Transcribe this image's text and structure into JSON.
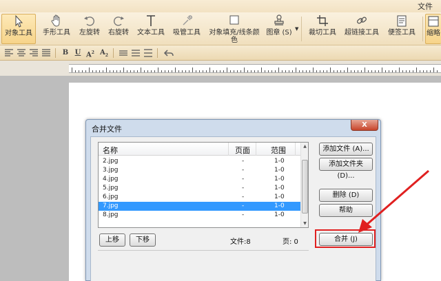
{
  "menu": {
    "file": "文件"
  },
  "toolbar": {
    "tools": [
      {
        "label": "对象工具",
        "icon": "cursor-arrow-icon"
      },
      {
        "label": "手形工具",
        "icon": "hand-icon"
      },
      {
        "label": "左旋转",
        "icon": "rotate-left-icon"
      },
      {
        "label": "右旋转",
        "icon": "rotate-right-icon"
      },
      {
        "label": "文本工具",
        "icon": "text-t-icon"
      },
      {
        "label": "吸管工具",
        "icon": "eyedropper-icon"
      },
      {
        "label": "对象填充/线条颜",
        "label2": "色",
        "icon": "fill-square-icon"
      },
      {
        "label": "图章 (S)",
        "icon": "stamp-icon"
      },
      {
        "label": "裁切工具",
        "icon": "crop-icon"
      },
      {
        "label": "超链接工具",
        "icon": "link-icon"
      },
      {
        "label": "便签工具",
        "icon": "note-icon"
      },
      {
        "label": "缩略",
        "icon": "thumbnail-icon"
      }
    ]
  },
  "format_bar": {
    "bold": "B",
    "italic": "U",
    "superscript": "A",
    "subscript": "A"
  },
  "dialog": {
    "title": "合并文件",
    "close": "X",
    "columns": {
      "name": "名称",
      "page": "页面",
      "range": "范围"
    },
    "rows": [
      {
        "name": "2.jpg",
        "page": "-",
        "range": "1-0"
      },
      {
        "name": "3.jpg",
        "page": "-",
        "range": "1-0"
      },
      {
        "name": "4.jpg",
        "page": "-",
        "range": "1-0"
      },
      {
        "name": "5.jpg",
        "page": "-",
        "range": "1-0"
      },
      {
        "name": "6.jpg",
        "page": "-",
        "range": "1-0"
      },
      {
        "name": "7.jpg",
        "page": "-",
        "range": "1-0",
        "selected": true
      },
      {
        "name": "8.jpg",
        "page": "-",
        "range": "1-0"
      }
    ],
    "buttons": {
      "add_file": "添加文件 (A)...",
      "add_folder": "添加文件夹 (D)...",
      "delete": "删除 (D)",
      "help": "帮助",
      "move_up": "上移",
      "move_down": "下移",
      "merge": "合并 (J)"
    },
    "status": {
      "files": "文件:8",
      "pages": "页: 0"
    }
  },
  "colors": {
    "selection": "#3399ff",
    "highlight": "#e02020",
    "ribbon": "#f0dfbd"
  }
}
